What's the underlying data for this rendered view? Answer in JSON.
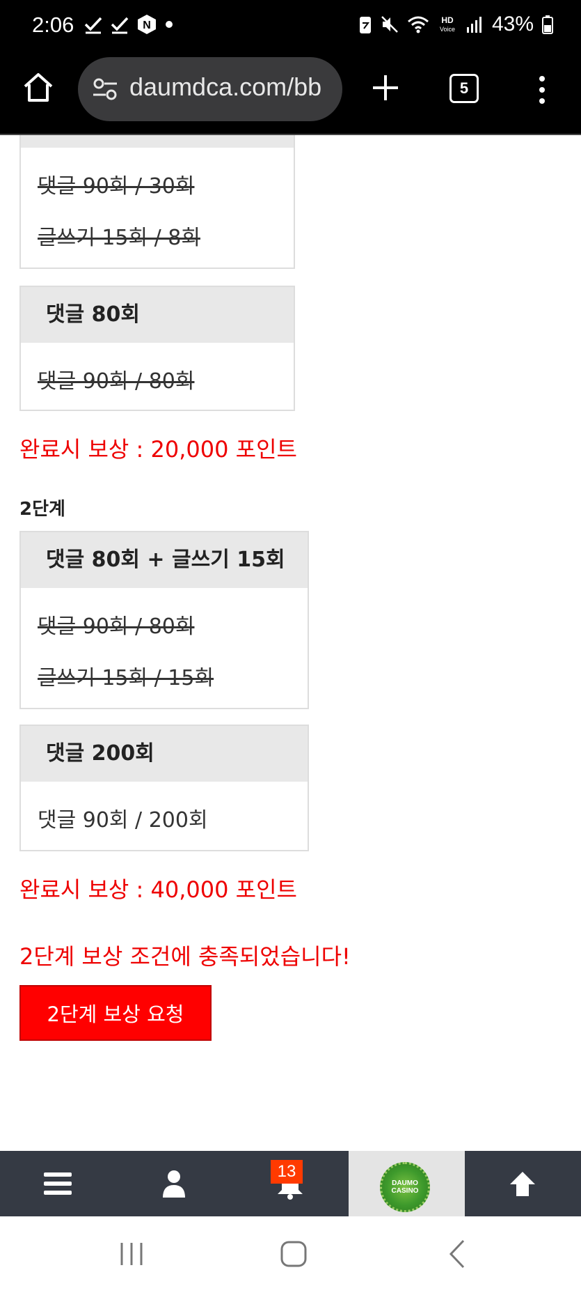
{
  "status_bar": {
    "time": "2:06",
    "battery": "43%",
    "icons": [
      "check-icon",
      "check-icon",
      "n-app-icon",
      "dot-icon",
      "battery-saver-icon",
      "mute-icon",
      "wifi-icon",
      "hd-voice-icon",
      "signal-icon",
      "battery-icon"
    ]
  },
  "browser": {
    "url": "daumdca.com/bb",
    "tab_count": "5"
  },
  "stage1": {
    "card_a": {
      "line1": "댓글 90회 / 30회",
      "line2": "글쓰기 15회 / 8회"
    },
    "card_b": {
      "title": "댓글 80회",
      "line1": "댓글 90회 / 80회"
    },
    "reward": "완료시 보상 : 20,000 포인트"
  },
  "stage2": {
    "title": "2단계",
    "card_a": {
      "title": "댓글 80회 + 글쓰기 15회",
      "line1": "댓글 90회 / 80회",
      "line2": "글쓰기 15회 / 15회"
    },
    "card_b": {
      "title": "댓글 200회",
      "line1": "댓글 90회 / 200회"
    },
    "reward": "완료시 보상 : 40,000 포인트",
    "notice": "2단계 보상 조건에 충족되었습니다!",
    "request_button": "2단계 보상 요청"
  },
  "bottom_nav": {
    "items": [
      "menu-icon",
      "user-icon",
      "bell-icon",
      "daumo-casino-logo",
      "arrow-up-icon"
    ],
    "notification_count": "13",
    "logo_text_1": "DAUMO",
    "logo_text_2": "CASINO"
  },
  "colors": {
    "accent_red": "#ff0000",
    "reward_text": "#e00000",
    "nav_bg": "#353a44",
    "card_head_bg": "#e8e8e8"
  }
}
